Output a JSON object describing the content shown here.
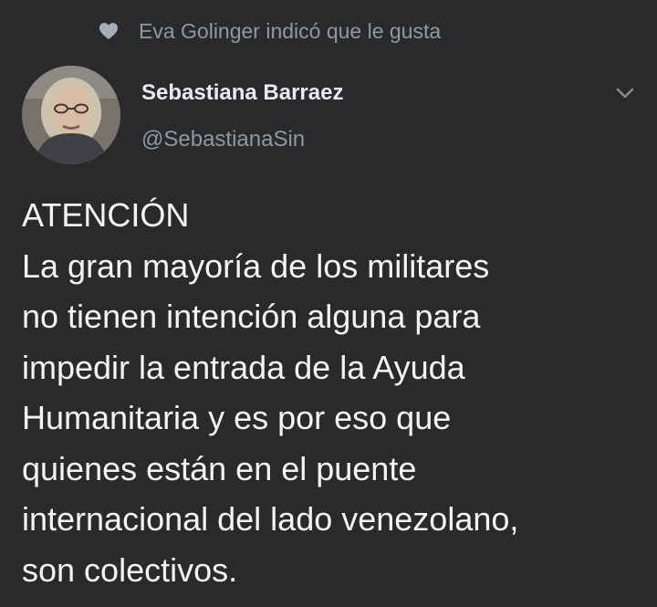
{
  "activity": {
    "icon": "heart-icon",
    "text": "Eva Golinger indicó que le gusta"
  },
  "author": {
    "name": "Sebastiana Barraez",
    "handle": "@SebastianaSin",
    "avatar_icon": "avatar"
  },
  "menu": {
    "icon": "chevron-down-icon"
  },
  "tweet": {
    "text": "ATENCIÓN\nLa gran mayoría de los militares\nno tienen intención alguna para\nimpedir la entrada de la Ayuda\nHumanitaria y es por eso que\nquienes están en el puente\ninternacional del lado venezolano,\nson colectivos."
  },
  "colors": {
    "background": "#2a2a2c",
    "primary_text": "#f3f4f5",
    "secondary_text": "#8b9aa3"
  }
}
